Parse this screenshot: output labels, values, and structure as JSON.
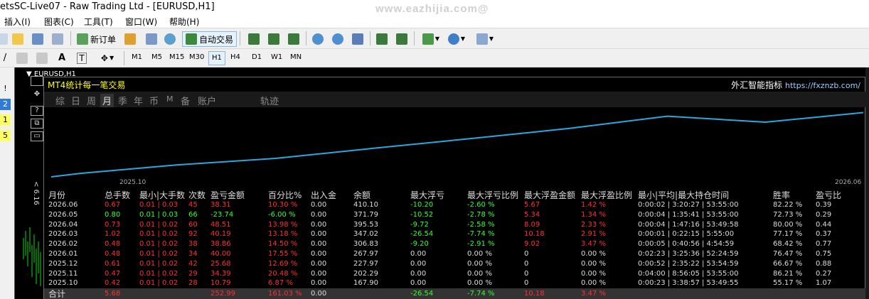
{
  "window": {
    "title": "etsSC-Live07 - Raw Trading Ltd - [EURUSD,H1]",
    "watermark": "www.eazhijia.com@"
  },
  "menu": [
    "插入(I)",
    "图表(C)",
    "工具(T)",
    "窗口(W)",
    "帮助(H)"
  ],
  "toolbar": {
    "new_order": "新订单",
    "auto_trading": "自动交易"
  },
  "timeframes": [
    "M1",
    "M5",
    "M15",
    "M30",
    "H1",
    "H4",
    "D1",
    "W1",
    "MN"
  ],
  "active_timeframe": "H1",
  "left_tags": [
    "!",
    "2",
    "1",
    "5"
  ],
  "chart": {
    "header": "EURUSD,H1",
    "vertical_label": "< 6.16",
    "ctrl_question": "?"
  },
  "panel": {
    "title": "MT4统计每一笔交易",
    "brand": "外汇智能指标",
    "url": "https://fxznzb.com/",
    "tabs": [
      "综",
      "日",
      "周",
      "月",
      "季",
      "年",
      "币",
      "M",
      "备",
      "账户",
      "轨迹"
    ],
    "active_tab": "月",
    "line_color": "#29a8e0",
    "x_axis_labels": [
      "2025.10",
      "2026.06"
    ]
  },
  "chart_data": {
    "type": "line",
    "x": [
      "2025.10",
      "2025.11",
      "2025.12",
      "2026.01",
      "2026.02",
      "2026.03",
      "2026.04",
      "2026.05",
      "2026.06"
    ],
    "series": [
      {
        "values": [
          167.9,
          202.29,
          227.97,
          267.97,
          306.83,
          347.02,
          395.53,
          371.79,
          410.1
        ]
      }
    ]
  },
  "table": {
    "headers": [
      "月份",
      "总手数",
      "最小|大手数",
      "次数",
      "盈亏金额",
      "百分比%",
      "出入金",
      "余额",
      "最大浮亏",
      "最大浮亏比例",
      "最大浮盈金额",
      "最大浮盈比例",
      "最小|平均|最大持仓时间",
      "胜率",
      "盈亏比"
    ],
    "rows": [
      [
        "2026.06",
        "0.67",
        "0.01 | 0.03",
        "45",
        "38.31",
        "10.30 %",
        "0.00",
        "410.10",
        "-10.20",
        "-2.60 %",
        "5.67",
        "1.42 %",
        "0:00:02 | 3:20:27 | 53:55:00",
        "82.22 %",
        "0.39"
      ],
      [
        "2026.05",
        "0.80",
        "0.01 | 0.03",
        "66",
        "-23.74",
        "-6.00 %",
        "0.00",
        "371.79",
        "-10.52",
        "-2.78 %",
        "5.34",
        "1.34 %",
        "0:00:04 | 1:35:41 | 53:55:00",
        "72.73 %",
        "0.29"
      ],
      [
        "2026.04",
        "0.73",
        "0.01 | 0.02",
        "60",
        "48.51",
        "13.98 %",
        "0.00",
        "395.53",
        "-9.72",
        "-2.58 %",
        "8.09",
        "2.33 %",
        "0:00:04 | 1:47:16 | 53:49:58",
        "80.00 %",
        "0.44"
      ],
      [
        "2026.03",
        "1.02",
        "0.01 | 0.02",
        "92",
        "40.19",
        "13.18 %",
        "0.00",
        "347.02",
        "-26.54",
        "-7.74 %",
        "10.18",
        "2.91 %",
        "0:00:01 | 0:22:15 | 5:55:00",
        "77.17 %",
        "0.37"
      ],
      [
        "2026.02",
        "0.48",
        "0.01 | 0.02",
        "38",
        "38.86",
        "14.50 %",
        "0.00",
        "306.83",
        "-9.20",
        "-2.91 %",
        "9.02",
        "3.47 %",
        "0:00:05 | 0:40:56 | 4:54:59",
        "68.42 %",
        "0.77"
      ],
      [
        "2026.01",
        "0.48",
        "0.01 | 0.02",
        "34",
        "40.00",
        "17.55 %",
        "0.00",
        "267.97",
        "0.00",
        "0.00 %",
        "0",
        "0.00 %",
        "0:02:23 | 3:25:36 | 52:24:59",
        "76.47 %",
        "0.75"
      ],
      [
        "2025.12",
        "0.61",
        "0.01 | 0.02",
        "42",
        "25.68",
        "12.69 %",
        "0.00",
        "227.97",
        "0.00",
        "0.00 %",
        "0",
        "0.00 %",
        "0:00:52 | 2:35:22 | 53:54:59",
        "66.67 %",
        "0.88"
      ],
      [
        "2025.11",
        "0.47",
        "0.01 | 0.02",
        "29",
        "34.39",
        "20.48 %",
        "0.00",
        "202.29",
        "0.00",
        "0.00 %",
        "0",
        "0.00 %",
        "0:04:00 | 8:56:05 | 53:55:00",
        "86.21 %",
        "0.27"
      ],
      [
        "2025.10",
        "0.42",
        "0.01 | 0.02",
        "28",
        "10.79",
        "6.87 %",
        "0.00",
        "167.90",
        "0.00",
        "0.00 %",
        "0",
        "0.00 %",
        "0:00:23 | 3:38:57 | 53:49:55",
        "55.17 %",
        "1.07"
      ]
    ],
    "row_colors": [
      "#ff3030",
      "#30ff30",
      "#ff3030",
      "#ff3030",
      "#ff3030",
      "#ff3030",
      "#ff3030",
      "#ff3030",
      "#ff3030"
    ],
    "total": {
      "label": "合计",
      "lots": "5.68",
      "profit": "252.99",
      "percent": "161.03 %",
      "deposit": "0.00",
      "max_float_loss": "-26.54",
      "max_float_loss_pct": "-7.74 %",
      "max_float_profit": "10.18",
      "max_float_profit_pct": "3.47 %"
    }
  },
  "colors": {
    "red": "#ff3030",
    "green": "#30ff30",
    "neutral": "#dcdcdc"
  }
}
